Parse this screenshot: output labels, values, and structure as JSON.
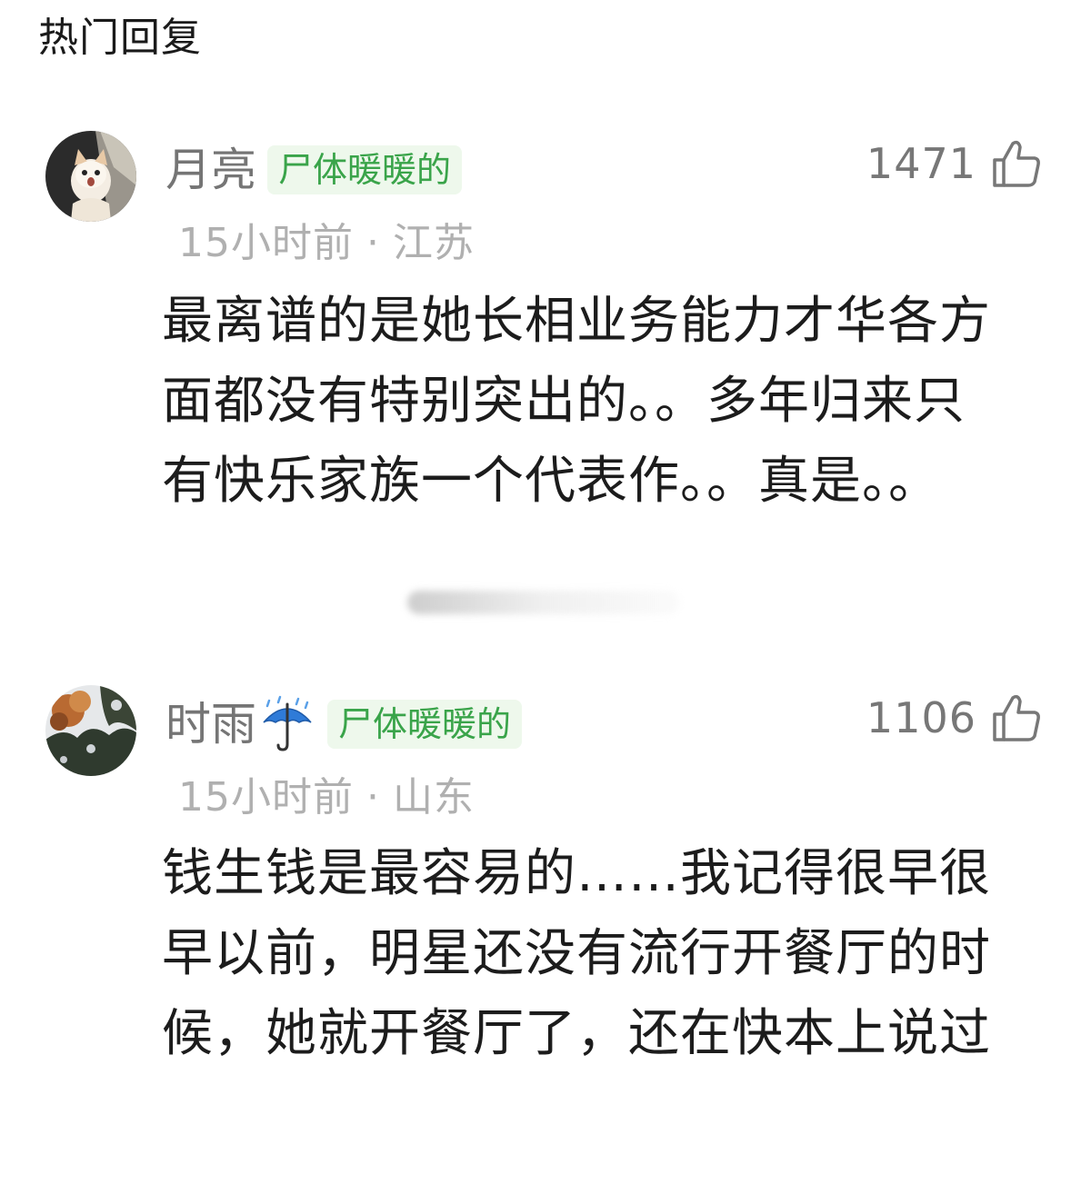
{
  "section": {
    "title": "热门回复"
  },
  "comments": [
    {
      "username": "月亮",
      "badge": "尸体暖暖的",
      "likes": "1471",
      "time": "15小时前",
      "separator": "·",
      "location": "江苏",
      "text": "最离谱的是她长相业务能力才华各方面都没有特别突出的。。多年归来只有快乐家族一个代表作。。真是。。",
      "avatar_icon": "cat-avatar",
      "like_icon": "thumbs-up-icon"
    },
    {
      "username": "时雨",
      "username_emoji": "umbrella-rain-icon",
      "badge": "尸体暖暖的",
      "likes": "1106",
      "time": "15小时前",
      "separator": "·",
      "location": "山东",
      "text": "钱生钱是最容易的……我记得很早很早以前，明星还没有流行开餐厅的时候，她就开餐厅了，还在快本上说过",
      "avatar_icon": "trees-avatar",
      "like_icon": "thumbs-up-icon"
    }
  ],
  "colors": {
    "badge_bg": "#eef8ec",
    "badge_text": "#3aa44a",
    "username": "#757575",
    "meta": "#b0b0b0",
    "body": "#1c1c1c"
  }
}
